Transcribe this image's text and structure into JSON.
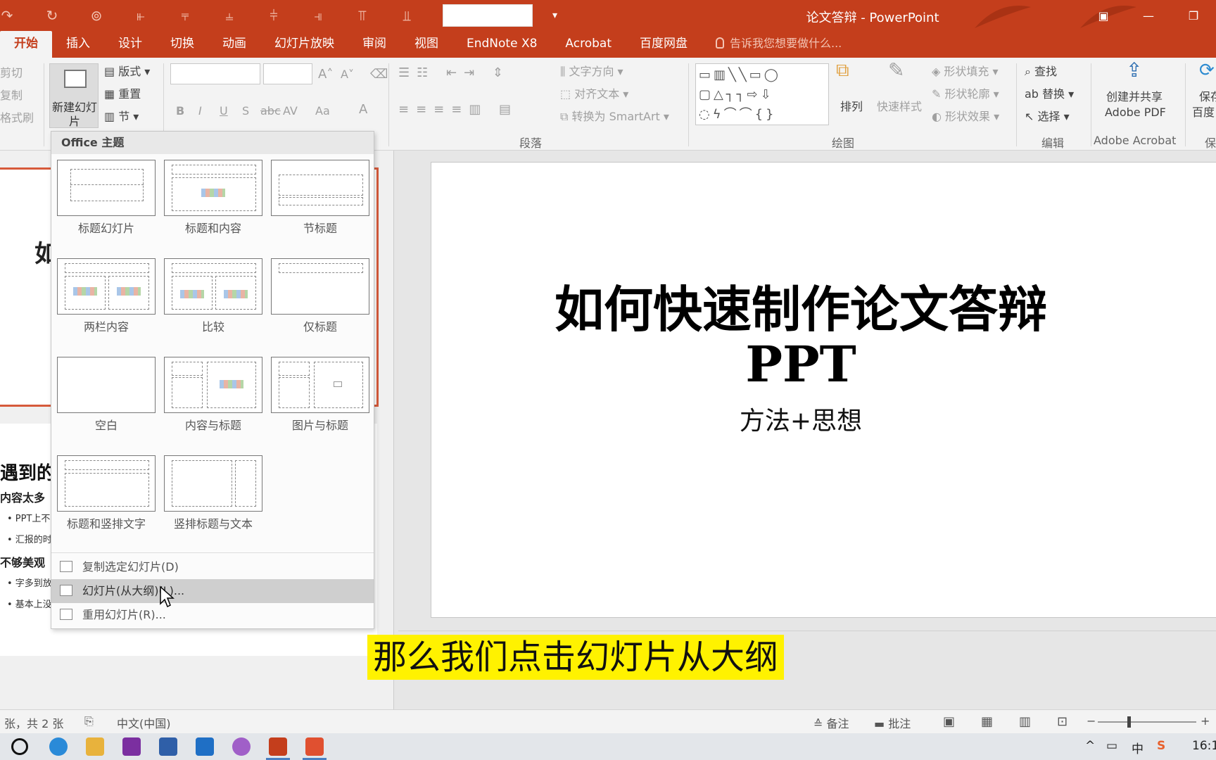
{
  "window": {
    "title": "论文答辩 - PowerPoint",
    "accent": "#c43e1c"
  },
  "tabs": [
    "开始",
    "插入",
    "设计",
    "切换",
    "动画",
    "幻灯片放映",
    "审阅",
    "视图",
    "EndNote X8",
    "Acrobat",
    "百度网盘"
  ],
  "tell_me": "告诉我您想要做什么...",
  "ribbon": {
    "clipboard": {
      "cut": "剪切",
      "copy": "复制",
      "format_painter": "格式刷"
    },
    "slides": {
      "new_slide": "新建幻灯片",
      "layout": "版式",
      "reset": "重置",
      "section": "节"
    },
    "font": {
      "bold": "B",
      "italic": "I",
      "underline": "U",
      "shadow": "S",
      "strike": "abc",
      "spacing": "AV",
      "case": "Aa",
      "color": "A"
    },
    "paragraph": {
      "text_direction": "文字方向",
      "align_text": "对齐文本",
      "convert_smartart": "转换为 SmartArt",
      "label": "段落"
    },
    "drawing": {
      "arrange": "排列",
      "quick_styles": "快速样式",
      "shape_fill": "形状填充",
      "shape_outline": "形状轮廓",
      "shape_effects": "形状效果",
      "label": "绘图"
    },
    "editing": {
      "find": "查找",
      "replace": "替换",
      "select": "选择",
      "label": "编辑"
    },
    "acrobat": {
      "create_share_1": "创建并共享",
      "create_share_2": "Adobe PDF",
      "label": "Adobe Acrobat"
    },
    "baidu": {
      "save_1": "保存",
      "save_2": "百度",
      "label": "保"
    }
  },
  "layout_menu": {
    "header": "Office 主题",
    "layouts": [
      "标题幻灯片",
      "标题和内容",
      "节标题",
      "两栏内容",
      "比较",
      "仅标题",
      "空白",
      "内容与标题",
      "图片与标题",
      "标题和竖排文字",
      "竖排标题与文本"
    ],
    "items": [
      "复制选定幻灯片(D)",
      "幻灯片(从大纲)(L)...",
      "重用幻灯片(R)..."
    ],
    "highlighted_index": 1
  },
  "thumbnails": {
    "slide1_partial_char": "如",
    "slide2": {
      "title": "遇到的",
      "h1": "内容太多",
      "b1": "• PPT上不",
      "b2": "• 汇报的时",
      "h2": "不够美观",
      "b3": "• 字多到放",
      "b4": "• 基本上没"
    }
  },
  "slide": {
    "title_line1": "如何快速制作论文答辩",
    "title_line2": "PPT",
    "subtitle": "方法+思想"
  },
  "caption": "那么我们点击幻灯片从大纲",
  "status": {
    "slide_count": "张，共 2 张",
    "language": "中文(中国)",
    "notes": "备注",
    "comments": "批注"
  },
  "tray": {
    "ime": "中",
    "time": "16:1"
  }
}
